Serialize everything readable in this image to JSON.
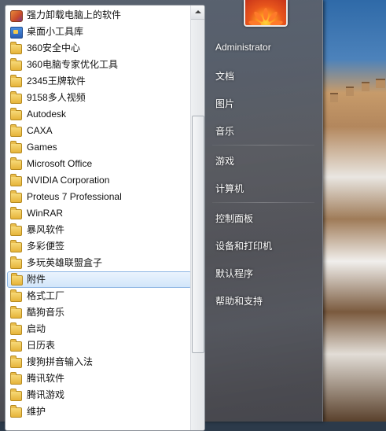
{
  "programs": {
    "items": [
      {
        "label": "强力卸载电脑上的软件",
        "icon": "uninstall-app-icon"
      },
      {
        "label": "桌面小工具库",
        "icon": "gadget-toolbox-icon"
      },
      {
        "label": "360安全中心",
        "icon": "folder-icon"
      },
      {
        "label": "360电脑专家优化工具",
        "icon": "folder-icon"
      },
      {
        "label": "2345王牌软件",
        "icon": "folder-icon"
      },
      {
        "label": "9158多人视频",
        "icon": "folder-icon"
      },
      {
        "label": "Autodesk",
        "icon": "folder-icon"
      },
      {
        "label": "CAXA",
        "icon": "folder-icon"
      },
      {
        "label": "Games",
        "icon": "folder-icon"
      },
      {
        "label": "Microsoft Office",
        "icon": "folder-icon"
      },
      {
        "label": "NVIDIA Corporation",
        "icon": "folder-icon"
      },
      {
        "label": "Proteus 7 Professional",
        "icon": "folder-icon"
      },
      {
        "label": "WinRAR",
        "icon": "folder-icon"
      },
      {
        "label": "暴风软件",
        "icon": "folder-icon"
      },
      {
        "label": "多彩便签",
        "icon": "folder-icon"
      },
      {
        "label": "多玩英雄联盟盒子",
        "icon": "folder-icon"
      },
      {
        "label": "附件",
        "icon": "folder-icon",
        "selected": true
      },
      {
        "label": "格式工厂",
        "icon": "folder-icon"
      },
      {
        "label": "酷狗音乐",
        "icon": "folder-icon"
      },
      {
        "label": "启动",
        "icon": "folder-icon"
      },
      {
        "label": "日历表",
        "icon": "folder-icon"
      },
      {
        "label": "搜狗拼音输入法",
        "icon": "folder-icon"
      },
      {
        "label": "腾讯软件",
        "icon": "folder-icon"
      },
      {
        "label": "腾讯游戏",
        "icon": "folder-icon"
      },
      {
        "label": "维护",
        "icon": "folder-icon"
      }
    ]
  },
  "right_pane": {
    "user_name": "Administrator",
    "documents": "文档",
    "pictures": "图片",
    "music": "音乐",
    "games": "游戏",
    "computer": "计算机",
    "control_panel": "控制面板",
    "devices_printers": "设备和打印机",
    "default_programs": "默认程序",
    "help_support": "帮助和支持"
  },
  "colors": {
    "selection_border": "#8fb7e4",
    "folder": "#e6b43a"
  }
}
